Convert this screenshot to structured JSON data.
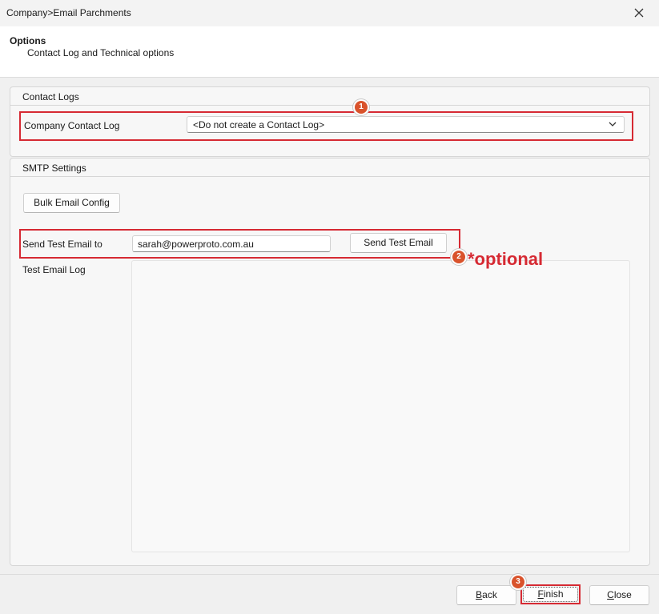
{
  "window": {
    "title": "Company>Email Parchments",
    "close_icon": "close-icon"
  },
  "header": {
    "title": "Options",
    "subtitle": "Contact Log and Technical options"
  },
  "contact_logs": {
    "title": "Contact Logs",
    "company_contact_log_label": "Company Contact Log",
    "company_contact_log_value": "<Do not create a Contact Log>"
  },
  "smtp": {
    "title": "SMTP Settings",
    "bulk_email_config_label": "Bulk Email Config",
    "send_test_email_label": "Send Test Email to",
    "send_test_email_value": "sarah@powerproto.com.au",
    "send_test_email_button": "Send Test Email",
    "test_email_log_label": "Test Email Log",
    "test_email_log_value": ""
  },
  "annotations": {
    "step1": "1",
    "step2": "2",
    "step3": "3",
    "optional_note": "*optional",
    "highlight_color": "#d62a33"
  },
  "footer": {
    "back_label": "Back",
    "finish_label": "Finish",
    "close_label": "Close"
  }
}
